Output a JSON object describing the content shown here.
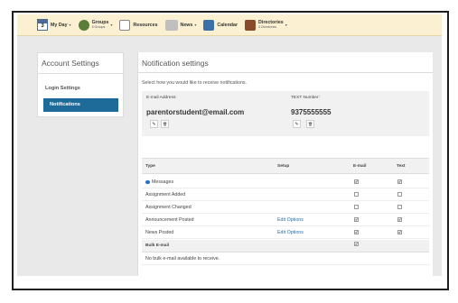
{
  "nav": {
    "day_number": "3",
    "my_day": "My Day",
    "groups": "Groups",
    "groups_sub": "5 Groups",
    "resources": "Resources",
    "news": "News",
    "calendar": "Calendar",
    "directories": "Directories",
    "directories_sub": "4 Directories",
    "caret": "▾"
  },
  "sidebar": {
    "title": "Account Settings",
    "items": [
      {
        "label": "Login Settings"
      },
      {
        "label": "Notifications",
        "active": true
      }
    ]
  },
  "main": {
    "title": "Notification settings",
    "description": "Select how you would like to receive notifications.",
    "email_label": "E-mail Address:",
    "email_value": "parentorstudent@email.com",
    "text_label": "TEXT Number:",
    "text_value": "9375555555",
    "edit_glyph": "✎",
    "delete_glyph": "🗑"
  },
  "table": {
    "headers": {
      "type": "Type",
      "setup": "Setup",
      "email": "E-mail",
      "text": "Text"
    },
    "rows": [
      {
        "type": "Messages",
        "setup": "",
        "email": true,
        "text": true
      },
      {
        "type": "Assignment Added",
        "setup": "",
        "email": false,
        "text": false
      },
      {
        "type": "Assignment Changed",
        "setup": "",
        "email": false,
        "text": false
      },
      {
        "type": "Announcement Posted",
        "setup": "Edit Options",
        "email": true,
        "text": true
      },
      {
        "type": "News Posted",
        "setup": "Edit Options",
        "email": true,
        "text": true
      }
    ],
    "bulk_label": "Bulk E-mail",
    "bulk_email": true,
    "bulk_note": "No bulk e-mail available to receive."
  },
  "colors": {
    "nav_bg": "#fbf1d2",
    "accent": "#1e6b99",
    "link": "#2b6ea8"
  }
}
